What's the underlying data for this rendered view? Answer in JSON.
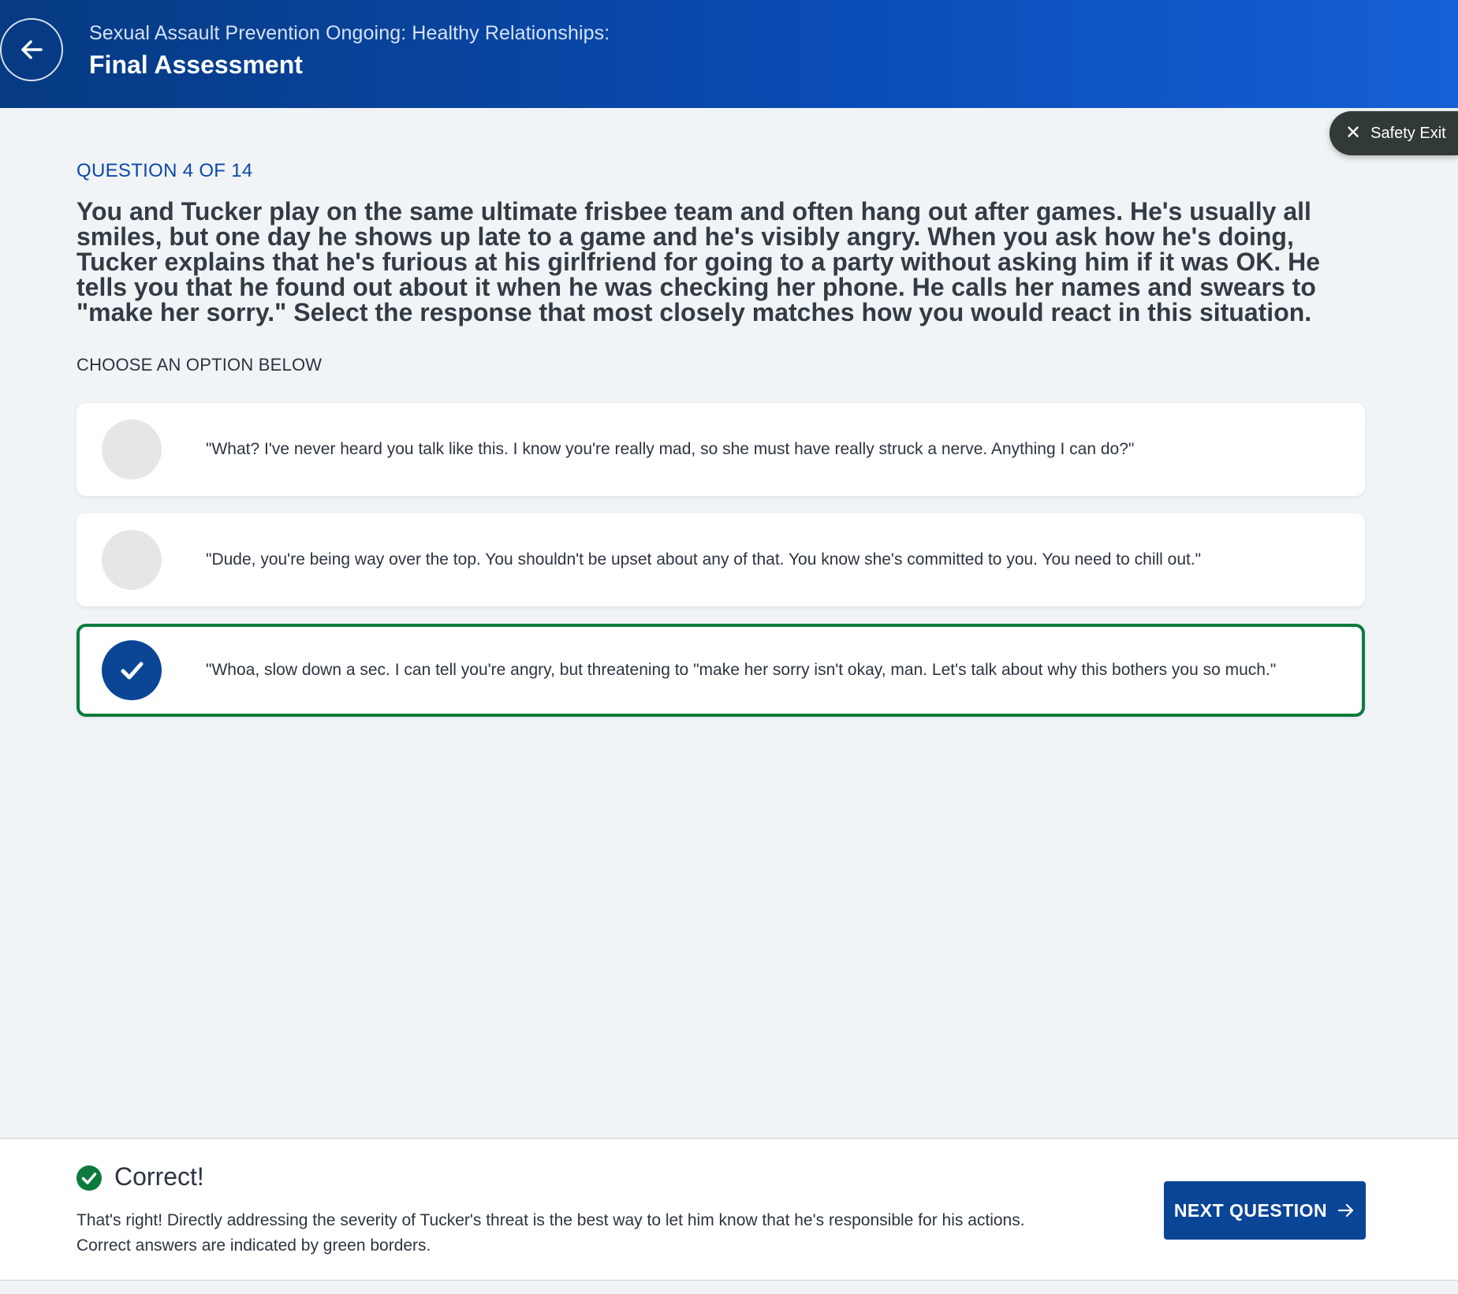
{
  "header": {
    "subtitle": "Sexual Assault Prevention Ongoing: Healthy Relationships:",
    "title": "Final Assessment",
    "back_icon": "arrow-left-icon"
  },
  "safety_exit": {
    "label": "Safety Exit",
    "icon": "close-icon"
  },
  "question": {
    "counter": "QUESTION 4 OF 14",
    "text": " You and Tucker play on the same ultimate frisbee team and often hang out after games. He's usually all smiles, but one day he shows up late to a game and he's visibly angry. When you ask how he's doing, Tucker explains that he's furious at his girlfriend for going to a party without asking him if it was OK. He tells you that he found out about it when he was checking her phone. He calls her names and swears to \"make her sorry.\" Select the response that most closely matches how you would react in this situation.",
    "choose_label": "CHOOSE AN OPTION BELOW"
  },
  "options": [
    {
      "text": "\"What? I've never heard you talk like this. I know you're really mad, so she must have really struck a nerve. Anything I can do?\"",
      "selected": false
    },
    {
      "text": "\"Dude, you're being way over the top. You shouldn't be upset about any of that. You know she's committed to you. You need to chill out.\"",
      "selected": false
    },
    {
      "text": "\"Whoa, slow down a sec. I can tell you're angry, but threatening to \"make her sorry isn't okay, man. Let's talk about why this bothers you so much.\"",
      "selected": true,
      "correct": true
    }
  ],
  "feedback": {
    "title": "Correct!",
    "message_line1": "That's right! Directly addressing the severity of Tucker's threat is the best way to let him know that he's responsible for his actions.",
    "message_line2": "Correct answers are indicated by green borders.",
    "icon": "check-circle-icon"
  },
  "next_button": {
    "label": "NEXT QUESTION",
    "icon": "arrow-right-icon"
  },
  "colors": {
    "header_start": "#063a82",
    "header_end": "#1560d6",
    "primary": "#0a4596",
    "correct_green": "#0c7a3c",
    "background": "#f1f4f7"
  }
}
